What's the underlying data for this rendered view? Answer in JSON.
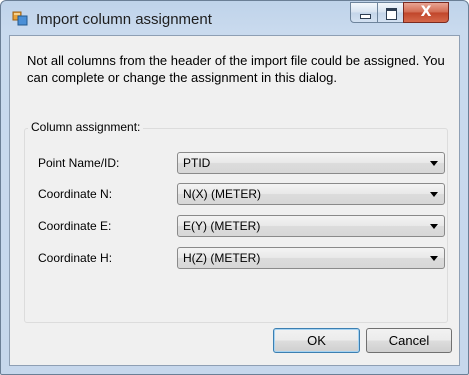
{
  "window": {
    "title": "Import column assignment",
    "icon": "app-window-icon",
    "controls": {
      "minimize": "minimize-icon",
      "maximize": "maximize-icon",
      "close": "X"
    }
  },
  "message": "Not all columns from the header of the import file could be assigned. You can complete or change the assignment in this dialog.",
  "group": {
    "title": "Column assignment:",
    "rows": [
      {
        "label": "Point Name/ID:",
        "value": "PTID"
      },
      {
        "label": "Coordinate N:",
        "value": "N(X) (METER)"
      },
      {
        "label": "Coordinate E:",
        "value": "E(Y) (METER)"
      },
      {
        "label": "Coordinate H:",
        "value": "H(Z) (METER)"
      }
    ]
  },
  "buttons": {
    "ok": "OK",
    "cancel": "Cancel"
  },
  "colors": {
    "title_bar": "#c6d7ec",
    "close_button": "#c0452a",
    "dialog_background": "#f0f0f0",
    "default_button_border": "#3c7fb1"
  }
}
